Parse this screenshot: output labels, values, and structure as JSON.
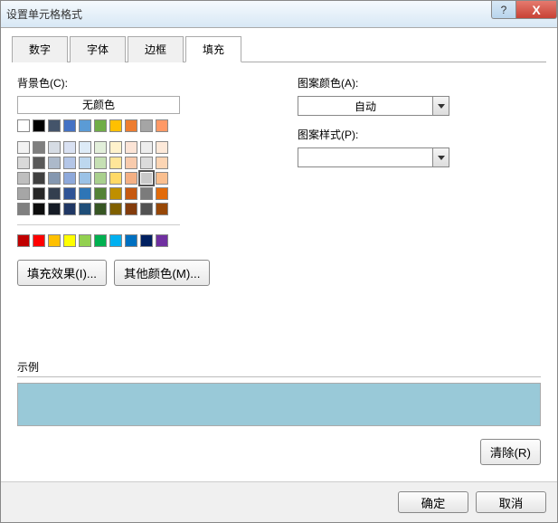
{
  "window": {
    "title": "设置单元格格式"
  },
  "titlebar": {
    "help": "?",
    "close": "X"
  },
  "tabs": [
    {
      "label": "数字",
      "active": false
    },
    {
      "label": "字体",
      "active": false
    },
    {
      "label": "边框",
      "active": false
    },
    {
      "label": "填充",
      "active": true
    }
  ],
  "fill": {
    "bgcolor_label": "背景色(C):",
    "nocolor_label": "无颜色",
    "fill_effects_label": "填充效果(I)...",
    "more_colors_label": "其他颜色(M)...",
    "pattern_color_label": "图案颜色(A):",
    "pattern_color_value": "自动",
    "pattern_style_label": "图案样式(P):",
    "pattern_style_value": ""
  },
  "palette": {
    "row1": [
      "#ffffff",
      "#000000",
      "#44546a",
      "#4472c4",
      "#5b9bd5",
      "#70ad47",
      "#ffc000",
      "#ed7d31",
      "#a5a5a5",
      "#ff9966"
    ],
    "row2": [
      "#f2f2f2",
      "#7f7f7f",
      "#d6dce4",
      "#d9e1f2",
      "#ddebf7",
      "#e2efda",
      "#fff2cc",
      "#fce4d6",
      "#ededed",
      "#fde9d9"
    ],
    "row3": [
      "#d9d9d9",
      "#595959",
      "#acb9ca",
      "#b4c6e7",
      "#bdd7ee",
      "#c6e0b4",
      "#ffe699",
      "#f8cbad",
      "#dbdbdb",
      "#fcd5b4"
    ],
    "row4": [
      "#bfbfbf",
      "#404040",
      "#8497b0",
      "#8ea9db",
      "#9bc2e6",
      "#a9d08e",
      "#ffd966",
      "#f4b084",
      "#c9c9c9",
      "#fabf8f"
    ],
    "row5": [
      "#a6a6a6",
      "#262626",
      "#333f4f",
      "#305496",
      "#2e75b6",
      "#548235",
      "#bf8f00",
      "#c65911",
      "#7b7b7b",
      "#e26b0a"
    ],
    "row6": [
      "#808080",
      "#0d0d0d",
      "#161c26",
      "#203764",
      "#1f4e78",
      "#375623",
      "#806000",
      "#833c0c",
      "#525252",
      "#974706"
    ],
    "standard": [
      "#c00000",
      "#ff0000",
      "#ffc000",
      "#ffff00",
      "#92d050",
      "#00b050",
      "#00b0f0",
      "#0070c0",
      "#002060",
      "#7030a0"
    ]
  },
  "selected_swatch": {
    "row": "row4",
    "index": 8
  },
  "sample": {
    "label": "示例",
    "color": "#99c9d8"
  },
  "buttons": {
    "clear": "清除(R)",
    "ok": "确定",
    "cancel": "取消"
  }
}
